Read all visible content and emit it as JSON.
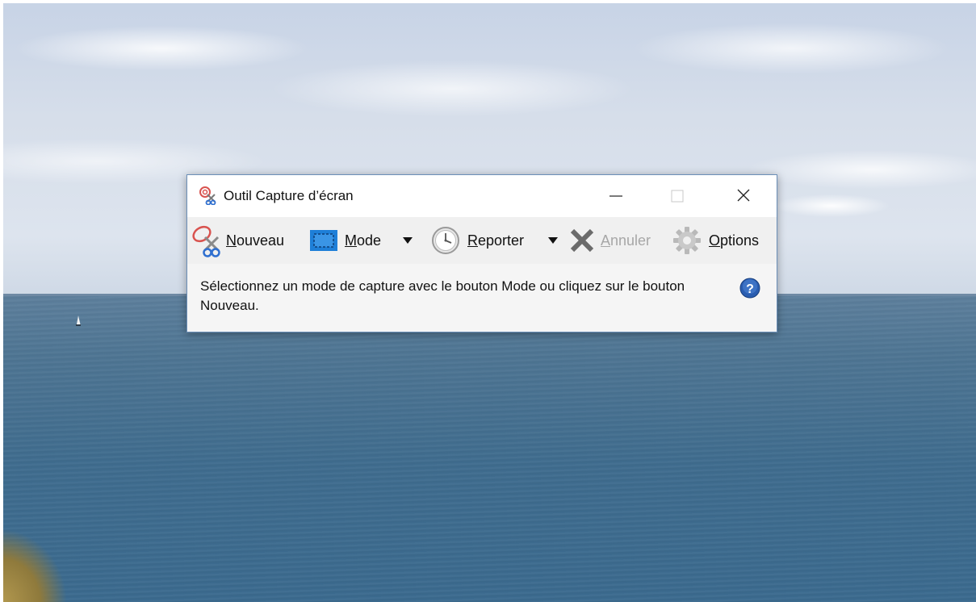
{
  "window": {
    "title": "Outil Capture d’écran"
  },
  "toolbar": {
    "nouveau": {
      "underline": "N",
      "rest": "ouveau"
    },
    "mode": {
      "underline": "M",
      "rest": "ode"
    },
    "reporter": {
      "underline": "R",
      "rest": "eporter"
    },
    "annuler": {
      "underline": "A",
      "rest": "nnuler"
    },
    "options": {
      "underline": "O",
      "rest": "ptions"
    }
  },
  "status": {
    "message": "Sélectionnez un mode de capture avec le bouton Mode ou cliquez sur le bouton Nouveau."
  },
  "colors": {
    "window_border": "#6b8fb8",
    "mode_icon_blue": "#1e7fd8",
    "help_icon_blue": "#2a5db0",
    "scissors_red": "#d9534f",
    "scissors_blue": "#2f6fd0"
  },
  "icons": [
    "snipping-tool-icon",
    "scissors-icon",
    "rectangle-mode-icon",
    "clock-icon",
    "cancel-x-icon",
    "gear-icon",
    "help-icon",
    "minimize-icon",
    "maximize-icon",
    "close-icon"
  ]
}
